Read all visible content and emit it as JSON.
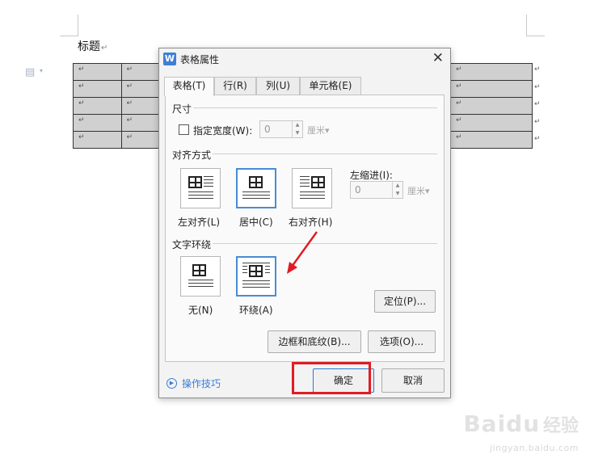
{
  "document": {
    "title": "标题",
    "para_mark": "↵",
    "cell_mark": "↵",
    "table": {
      "rows": 5,
      "left_cols": 2,
      "right_cols": 1
    }
  },
  "watermark": {
    "logo": "Bai",
    "logo_paw": "du",
    "cn": "经验",
    "url": "jingyan.baidu.com"
  },
  "dialog": {
    "app_icon": "W",
    "title": "表格属性",
    "tabs": [
      {
        "label": "表格(T)",
        "active": true
      },
      {
        "label": "行(R)",
        "active": false
      },
      {
        "label": "列(U)",
        "active": false
      },
      {
        "label": "单元格(E)",
        "active": false
      }
    ],
    "size": {
      "section": "尺寸",
      "specify_width_label": "指定宽度(W):",
      "specify_width_checked": false,
      "width_value": "0",
      "width_unit": "厘米▾"
    },
    "alignment": {
      "section": "对齐方式",
      "options": [
        {
          "label": "左对齐(L)",
          "selected": false
        },
        {
          "label": "居中(C)",
          "selected": true
        },
        {
          "label": "右对齐(H)",
          "selected": false
        }
      ],
      "indent_label": "左缩进(I):",
      "indent_value": "0",
      "indent_unit": "厘米▾"
    },
    "wrapping": {
      "section": "文字环绕",
      "options": [
        {
          "label": "无(N)",
          "selected": false
        },
        {
          "label": "环绕(A)",
          "selected": true
        }
      ],
      "position_button": "定位(P)..."
    },
    "borders_button": "边框和底纹(B)...",
    "options_button": "选项(O)...",
    "tips_label": "操作技巧",
    "ok_button": "确定",
    "cancel_button": "取消"
  },
  "colors": {
    "accent": "#4a8bd2",
    "highlight": "#e01b24",
    "link": "#3a7bd5"
  }
}
